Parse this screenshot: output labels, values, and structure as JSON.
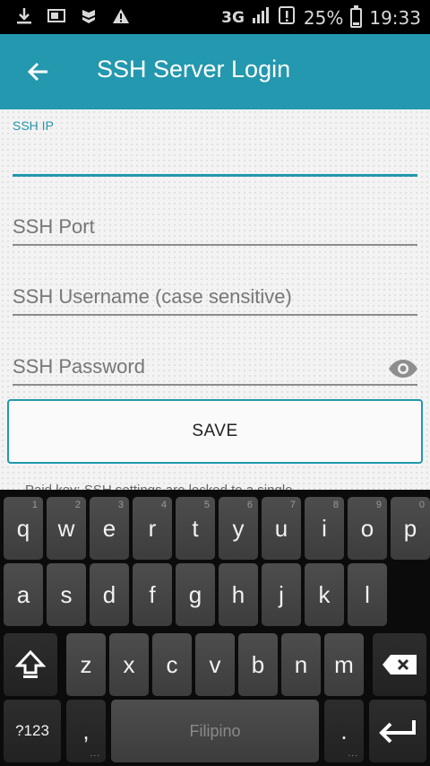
{
  "status_bar": {
    "icons": [
      "download-icon",
      "screen-icon",
      "shield-icon",
      "warning-icon"
    ],
    "network": "3G",
    "battery": "25%",
    "battery_level": 0.25,
    "time": "19:33"
  },
  "app_bar": {
    "title": "SSH Server Login",
    "back_icon": "arrow-left-icon"
  },
  "form": {
    "ip": {
      "label": "SSH IP",
      "value": ""
    },
    "port": {
      "placeholder": "SSH Port",
      "value": ""
    },
    "username": {
      "placeholder": "SSH Username (case sensitive)",
      "value": ""
    },
    "password": {
      "placeholder": "SSH Password",
      "value": "",
      "toggle_icon": "eye-icon"
    },
    "save_label": "SAVE",
    "hint_text": "Paid key: SSH settings are locked to a single..."
  },
  "colors": {
    "accent": "#2398ae",
    "background": "#f3f3f3",
    "keyboard": "#0b0b0b"
  },
  "keyboard": {
    "row1": [
      {
        "k": "q",
        "n": "1"
      },
      {
        "k": "w",
        "n": "2"
      },
      {
        "k": "e",
        "n": "3"
      },
      {
        "k": "r",
        "n": "4"
      },
      {
        "k": "t",
        "n": "5"
      },
      {
        "k": "y",
        "n": "6"
      },
      {
        "k": "u",
        "n": "7"
      },
      {
        "k": "i",
        "n": "8"
      },
      {
        "k": "o",
        "n": "9"
      },
      {
        "k": "p",
        "n": "0"
      }
    ],
    "row2": [
      "a",
      "s",
      "d",
      "f",
      "g",
      "h",
      "j",
      "k",
      "l"
    ],
    "row3": [
      "z",
      "x",
      "c",
      "v",
      "b",
      "n",
      "m"
    ],
    "symbols_label": "?123",
    "comma_label": ",",
    "space_label": "Filipino",
    "period_label": ".",
    "shift_icon": "shift-icon",
    "backspace_icon": "backspace-icon",
    "enter_icon": "enter-icon"
  }
}
